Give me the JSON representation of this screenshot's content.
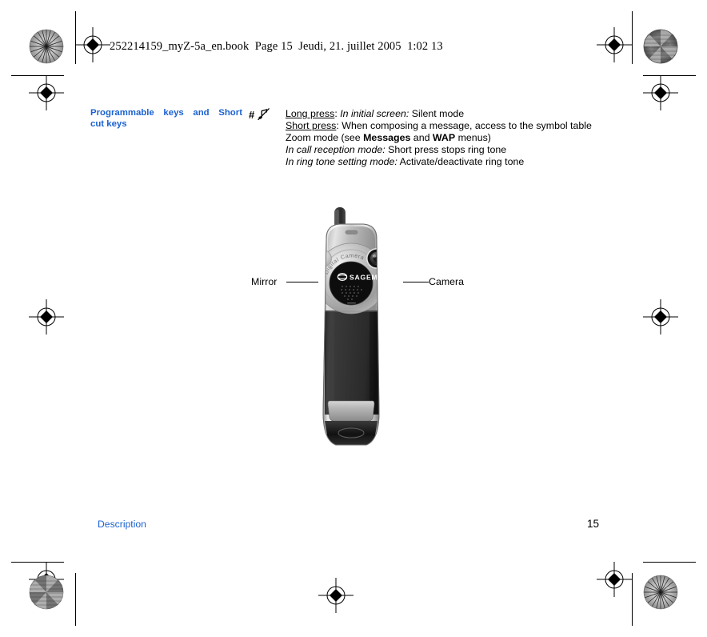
{
  "document": {
    "header_slug": "252214159_myZ-5a_en.book  Page 15  Jeudi, 21. juillet 2005  1:02 13",
    "accent_color": "#1b62d0"
  },
  "entry": {
    "key_label_line1": "Programmable keys and Short",
    "key_label_line2": "cut keys",
    "symbol_hash": "#",
    "symbol_icon": "muted-note-icon",
    "lines": [
      {
        "segments": [
          {
            "text": "Long press",
            "style": "underline"
          },
          {
            "text": ": ",
            "style": "normal"
          },
          {
            "text": "In initial screen:",
            "style": "italic"
          },
          {
            "text": " Silent mode",
            "style": "normal"
          }
        ]
      },
      {
        "segments": [
          {
            "text": "Short press",
            "style": "underline"
          },
          {
            "text": ": When composing a message, access to the symbol table",
            "style": "normal"
          }
        ]
      },
      {
        "segments": [
          {
            "text": "Zoom mode (see ",
            "style": "normal"
          },
          {
            "text": "Messages",
            "style": "bold"
          },
          {
            "text": " and ",
            "style": "normal"
          },
          {
            "text": "WAP",
            "style": "bold"
          },
          {
            "text": " menus)",
            "style": "normal"
          }
        ]
      },
      {
        "segments": [
          {
            "text": "In call reception mode:",
            "style": "italic"
          },
          {
            "text": " Short press stops ring tone",
            "style": "normal"
          }
        ]
      },
      {
        "segments": [
          {
            "text": "In ring tone setting mode:",
            "style": "italic"
          },
          {
            "text": " Activate/deactivate ring tone",
            "style": "normal"
          }
        ]
      }
    ]
  },
  "figure": {
    "callout_left": "Mirror",
    "callout_right": "Camera",
    "brand": "SAGEM",
    "curved_text": "Digital Camera"
  },
  "footer": {
    "section": "Description",
    "page_number": "15"
  }
}
